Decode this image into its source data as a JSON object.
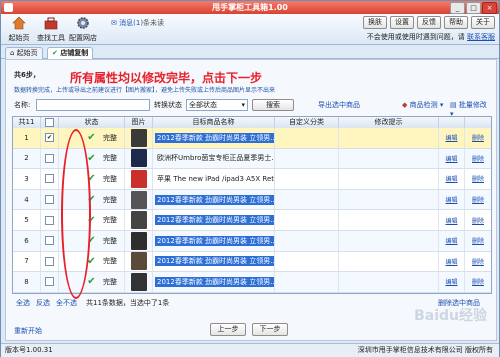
{
  "window": {
    "title": "甩手掌柜工具箱1.00",
    "controls": [
      "_",
      "□",
      "×"
    ]
  },
  "toolbar": {
    "tools": [
      {
        "label": "起始页",
        "icon": "home-icon"
      },
      {
        "label": "查找工具",
        "icon": "toolbox-icon"
      },
      {
        "label": "配置网店",
        "icon": "gear-icon"
      }
    ],
    "message_label": "消息(",
    "message_count": "1",
    "message_suffix": ")条未读",
    "buttons": [
      "换肤",
      "设置",
      "反馈",
      "帮助",
      "关于"
    ],
    "notice": "不会使用或使用时遇到问题，请",
    "notice_link": "联系客服"
  },
  "tabs": [
    {
      "label": "起始页",
      "active": false
    },
    {
      "label": "店铺复制",
      "active": true
    }
  ],
  "step": {
    "label": "共6步，"
  },
  "callout": "所有属性均以修改完毕，点击下一步",
  "tip": "数据转换完成，上传或导出之前建议进行【图片搬家】，避免上传失败或上传后商品图片显示不出来",
  "filter": {
    "name_label": "名称:",
    "name_value": "",
    "status_label": "转换状态",
    "status_value": "全部状态",
    "search_label": "搜索",
    "export_link": "导出选中商品",
    "detect_label": "商品检测",
    "batch_label": "批量修改"
  },
  "table": {
    "headers": [
      "共11",
      "",
      "状态",
      "图片",
      "目标商品名称",
      "自定义分类",
      "修改提示",
      "",
      ""
    ],
    "rows": [
      {
        "num": "1",
        "checked": true,
        "status": "完整",
        "name": "2012春季新款 劲霸时尚男装 立领男...",
        "thumb": "#3a3a3a",
        "highlight": true,
        "edit": "编辑",
        "del": "删除"
      },
      {
        "num": "2",
        "checked": false,
        "status": "完整",
        "name": "欧洲杯Umbro茵宝专柜正品夏季男士...",
        "thumb": "#1e2a4a",
        "highlight": false,
        "edit": "编辑",
        "del": "删除"
      },
      {
        "num": "3",
        "checked": false,
        "status": "完整",
        "name": "苹果 The new iPad /ipad3 A5X Retina...",
        "thumb": "#c9302c",
        "highlight": false,
        "edit": "编辑",
        "del": "删除"
      },
      {
        "num": "4",
        "checked": false,
        "status": "完整",
        "name": "2012春季新款 劲霸时尚男装 立领男...",
        "thumb": "#555555",
        "highlight": false,
        "edit": "编辑",
        "del": "删除"
      },
      {
        "num": "5",
        "checked": false,
        "status": "完整",
        "name": "2012春季新款 劲霸时尚男装 立领男...",
        "thumb": "#444444",
        "highlight": false,
        "edit": "编辑",
        "del": "删除"
      },
      {
        "num": "6",
        "checked": false,
        "status": "完整",
        "name": "2012春季新款 劲霸时尚男装 立领男...",
        "thumb": "#2e2e2e",
        "highlight": false,
        "edit": "编辑",
        "del": "删除"
      },
      {
        "num": "7",
        "checked": false,
        "status": "完整",
        "name": "2012春季新款 劲霸时尚男装 立领男...",
        "thumb": "#5a4a3a",
        "highlight": false,
        "edit": "编辑",
        "del": "删除"
      },
      {
        "num": "8",
        "checked": false,
        "status": "完整",
        "name": "2012春季新款 劲霸时尚男装 立领男...",
        "thumb": "#333333",
        "highlight": false,
        "edit": "编辑",
        "del": "删除"
      }
    ]
  },
  "selection": {
    "select_all": "全选",
    "invert": "反选",
    "select_none": "全不选",
    "summary": "共11条数据，当选中了1条",
    "delete_selected": "删除选中商品"
  },
  "nav": {
    "restart": "重新开始",
    "prev": "上一步",
    "next": "下一步"
  },
  "status": {
    "version": "版本号1.00.31",
    "company": "深圳市甩手掌柜信息技术有限公司 版权所有"
  },
  "watermark": "Baidu经验",
  "colors": {
    "title_bar": "#d74331",
    "callout": "#e8202a",
    "link": "#1a4fb0",
    "check": "#21a33a",
    "highlight_row": "#fff6bf"
  }
}
